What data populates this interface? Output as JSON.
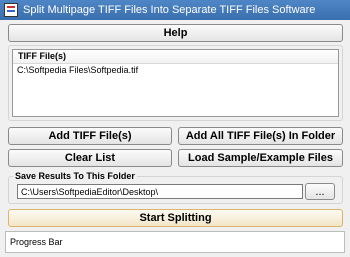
{
  "window": {
    "title": "Split Multipage TIFF Files Into Separate TIFF Files Software"
  },
  "buttons": {
    "help": "Help",
    "add_files": "Add TIFF File(s)",
    "add_folder": "Add All TIFF File(s) In Folder",
    "clear_list": "Clear List",
    "load_sample": "Load Sample/Example Files",
    "browse": "...",
    "start": "Start Splitting"
  },
  "file_list": {
    "header": "TIFF File(s)",
    "items": [
      "C:\\Softpedia Files\\Softpedia.tif"
    ]
  },
  "save_group": {
    "label": "Save Results To This Folder",
    "path": "C:\\Users\\SoftpediaEditor\\Desktop\\"
  },
  "progress": {
    "label": "Progress Bar"
  }
}
